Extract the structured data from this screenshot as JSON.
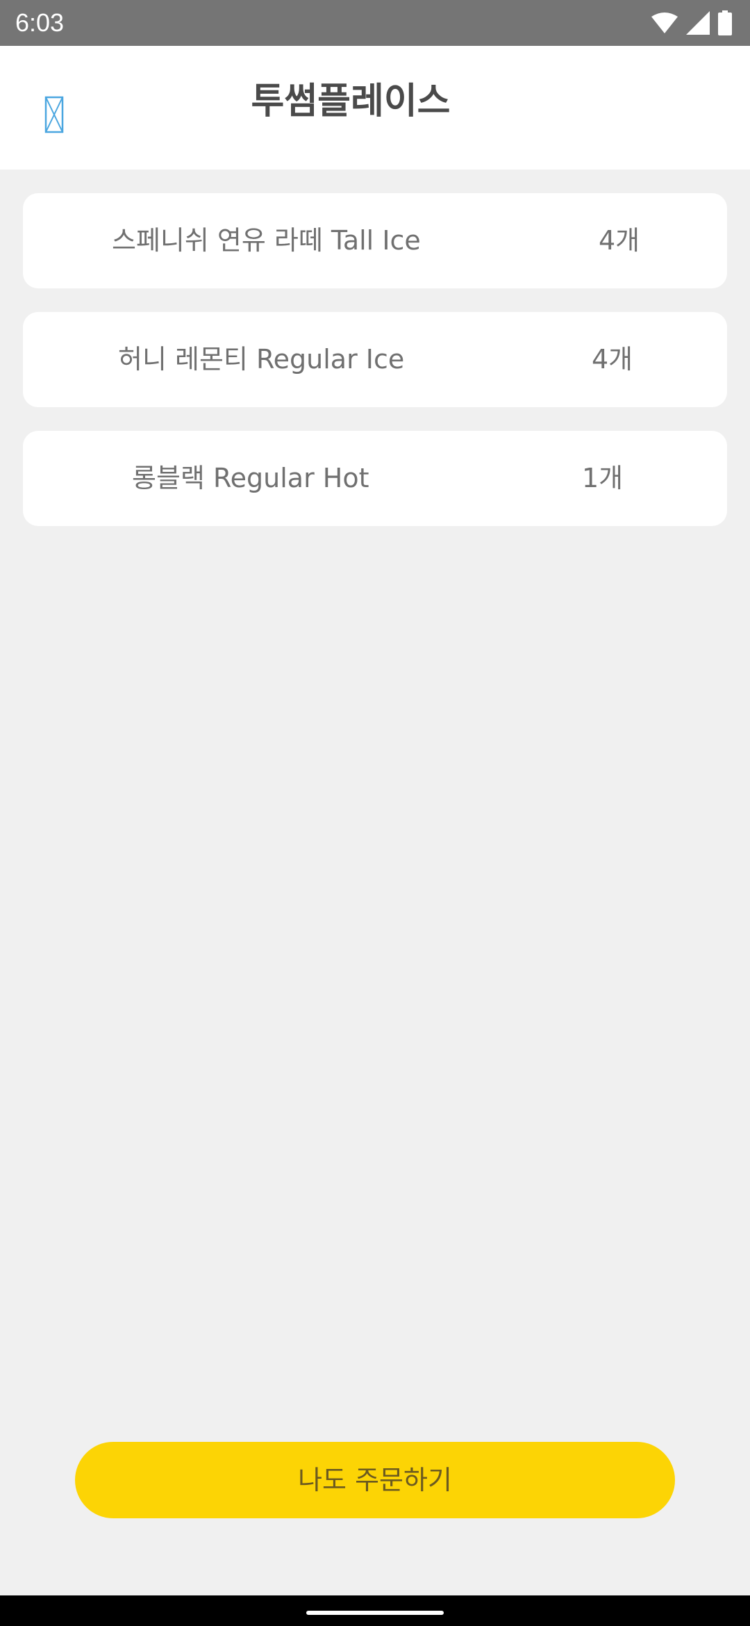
{
  "status_bar": {
    "time": "6:03",
    "icons": [
      "wifi-icon",
      "signal-icon",
      "battery-icon"
    ]
  },
  "header": {
    "title": "투썸플레이스",
    "back_icon": "broken-image-icon"
  },
  "orders": [
    {
      "name": "스페니쉬 연유 라떼 Tall Ice",
      "quantity": "4개"
    },
    {
      "name": "허니 레몬티 Regular Ice",
      "quantity": "4개"
    },
    {
      "name": "롱블랙 Regular Hot",
      "quantity": "1개"
    }
  ],
  "actions": {
    "order_button_label": "나도 주문하기"
  },
  "colors": {
    "accent": "#fcd405",
    "status_bar": "#757575",
    "background": "#f0f0f0"
  }
}
